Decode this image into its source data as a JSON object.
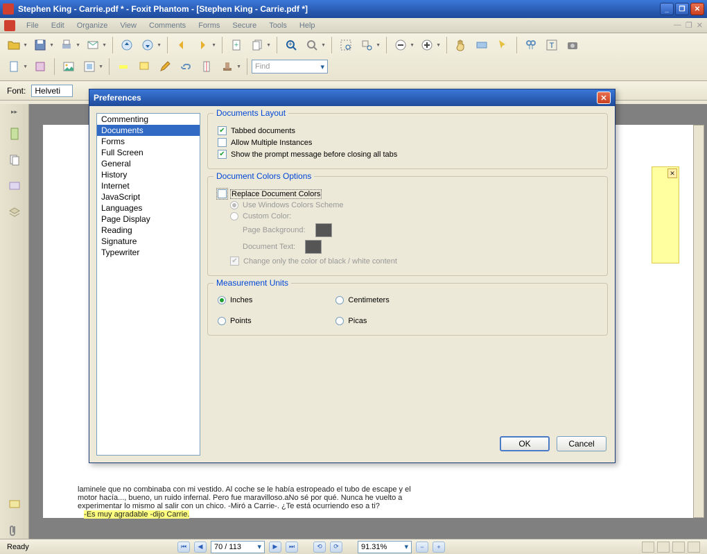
{
  "window": {
    "title": "Stephen King - Carrie.pdf * - Foxit Phantom - [Stephen King - Carrie.pdf *]"
  },
  "menubar": {
    "items": [
      "File",
      "Edit",
      "Organize",
      "View",
      "Comments",
      "Forms",
      "Secure",
      "Tools",
      "Help"
    ]
  },
  "fontbar": {
    "label": "Font:",
    "value": "Helveti"
  },
  "statusbar": {
    "ready": "Ready",
    "page": "70 / 113",
    "zoom": "91.31%"
  },
  "document": {
    "line1": "laminele que no combinaba con mi vestido. Al coche se le había estropeado el tubo de escape y el",
    "line2": "motor hacía..., bueno, un ruido infernal. Pero fue maravilloso.aNo sé por qué. Nunca he vuelto a",
    "line3": "experimentar lo mismo al salir con un chico. -Miró a Carrie-. ¿Te está ocurriendo eso a ti?",
    "line4": "-Es muy agradable -dijo Carrie."
  },
  "preferences": {
    "title": "Preferences",
    "categories": [
      "Commenting",
      "Documents",
      "Forms",
      "Full Screen",
      "General",
      "History",
      "Internet",
      "JavaScript",
      "Languages",
      "Page Display",
      "Reading",
      "Signature",
      "Typewriter"
    ],
    "selected": "Documents",
    "layout": {
      "legend": "Documents Layout",
      "tabbed": "Tabbed documents",
      "multi": "Allow Multiple Instances",
      "prompt": "Show the prompt message before closing all tabs"
    },
    "colors": {
      "legend": "Document Colors Options",
      "replace": "Replace Document Colors",
      "windows": "Use Windows Colors Scheme",
      "custom": "Custom Color:",
      "pagebg": "Page Background:",
      "doctext": "Document Text:",
      "changeonly": "Change only  the color of black / white content"
    },
    "units": {
      "legend": "Measurement Units",
      "inches": "Inches",
      "centimeters": "Centimeters",
      "points": "Points",
      "picas": "Picas"
    },
    "ok": "OK",
    "cancel": "Cancel"
  }
}
